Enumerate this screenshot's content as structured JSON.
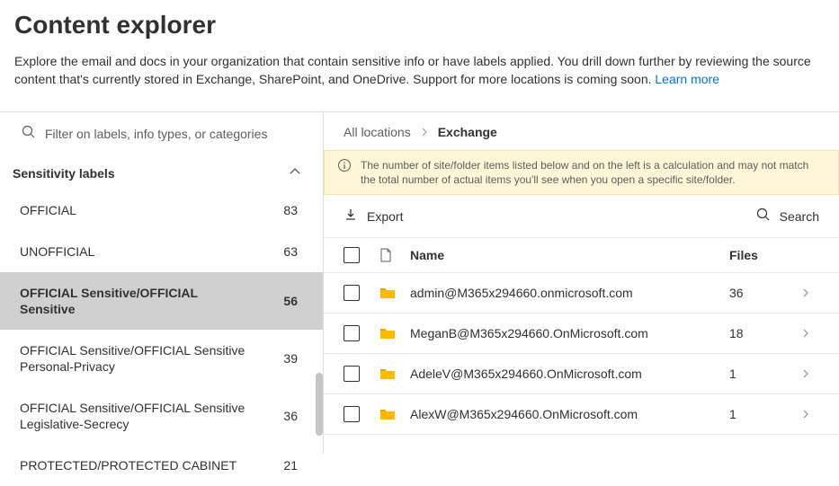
{
  "header": {
    "title": "Content explorer",
    "description": "Explore the email and docs in your organization that contain sensitive info or have labels applied. You drill down further by reviewing the source content that's currently stored in Exchange, SharePoint, and OneDrive. Support for more locations is coming soon. ",
    "learn_more": "Learn more"
  },
  "filter": {
    "placeholder": "Filter on labels, info types, or categories"
  },
  "sidebar": {
    "section_title": "Sensitivity labels",
    "items": [
      {
        "name": "OFFICIAL",
        "count": "83"
      },
      {
        "name": "UNOFFICIAL",
        "count": "63"
      },
      {
        "name": "OFFICIAL Sensitive/OFFICIAL Sensitive",
        "count": "56"
      },
      {
        "name": "OFFICIAL Sensitive/OFFICIAL Sensitive Personal-Privacy",
        "count": "39"
      },
      {
        "name": "OFFICIAL Sensitive/OFFICIAL Sensitive Legislative-Secrecy",
        "count": "36"
      },
      {
        "name": "PROTECTED/PROTECTED CABINET",
        "count": "21"
      }
    ],
    "selected_index": 2
  },
  "breadcrumb": {
    "root": "All locations",
    "current": "Exchange"
  },
  "banner": {
    "text": "The number of site/folder items listed below and on the left is a calculation and may not match the total number of actual items you'll see when you open a specific site/folder."
  },
  "toolbar": {
    "export_label": "Export",
    "search_label": "Search"
  },
  "table": {
    "headers": {
      "name": "Name",
      "files": "Files"
    },
    "rows": [
      {
        "name": "admin@M365x294660.onmicrosoft.com",
        "files": "36"
      },
      {
        "name": "MeganB@M365x294660.OnMicrosoft.com",
        "files": "18"
      },
      {
        "name": "AdeleV@M365x294660.OnMicrosoft.com",
        "files": "1"
      },
      {
        "name": "AlexW@M365x294660.OnMicrosoft.com",
        "files": "1"
      }
    ]
  }
}
